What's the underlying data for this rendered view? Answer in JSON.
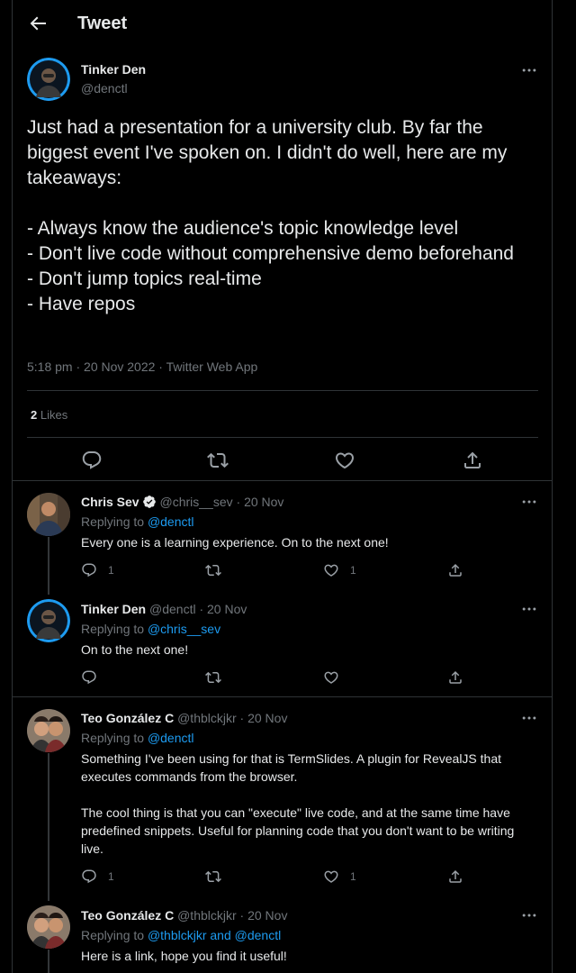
{
  "header": {
    "title": "Tweet"
  },
  "main_tweet": {
    "name": "Tinker Den",
    "handle": "@denctl",
    "text": "Just had a presentation for a university club. By far the biggest event I've spoken on. I didn't do well, here are my takeaways:\n\n- Always know the audience's topic knowledge level\n- Don't live code without comprehensive demo beforehand\n- Don't jump topics real-time\n- Have repos",
    "meta": "5:18 pm · 20 Nov 2022 · Twitter Web App",
    "likes_count": "2",
    "likes_label": "Likes"
  },
  "replies": [
    {
      "name": "Chris Sev",
      "verified": true,
      "handle": "@chris__sev",
      "time": "· 20 Nov",
      "replying_label": "Replying to",
      "replying_to": "@denctl",
      "text": "Every one is a learning experience. On to the next one!",
      "reply_count": "1",
      "like_count": "1"
    },
    {
      "name": "Tinker Den",
      "handle": "@denctl",
      "time": "· 20 Nov",
      "replying_label": "Replying to",
      "replying_to": "@chris__sev",
      "text": "On to the next one!",
      "reply_count": "",
      "like_count": ""
    },
    {
      "name": "Teo González C",
      "handle": "@thblckjkr",
      "time": "· 20 Nov",
      "replying_label": "Replying to",
      "replying_to": "@denctl",
      "text": "Something I've been using for that is TermSlides. A plugin for RevealJS that executes commands from the browser.\n\nThe cool thing is that you can \"execute\" live code, and at the same time have predefined snippets. Useful for planning code that you don't want to be writing live.",
      "reply_count": "1",
      "like_count": "1"
    },
    {
      "name": "Teo González C",
      "handle": "@thblckjkr",
      "time": "· 20 Nov",
      "replying_label": "Replying to",
      "replying_to": "@thblckjkr and @denctl",
      "text": "Here is a link, hope you find it useful!"
    }
  ],
  "icons": {
    "back": "arrow-left-icon",
    "more": "more-horizontal-icon",
    "reply": "reply-bubble-icon",
    "retweet": "retweet-icon",
    "like": "heart-icon",
    "share": "share-icon",
    "verified": "verified-badge-icon"
  },
  "colors": {
    "background": "#000000",
    "text": "#e7e9ea",
    "muted": "#71767b",
    "link": "#1d9bf0",
    "border": "#2f3336"
  }
}
